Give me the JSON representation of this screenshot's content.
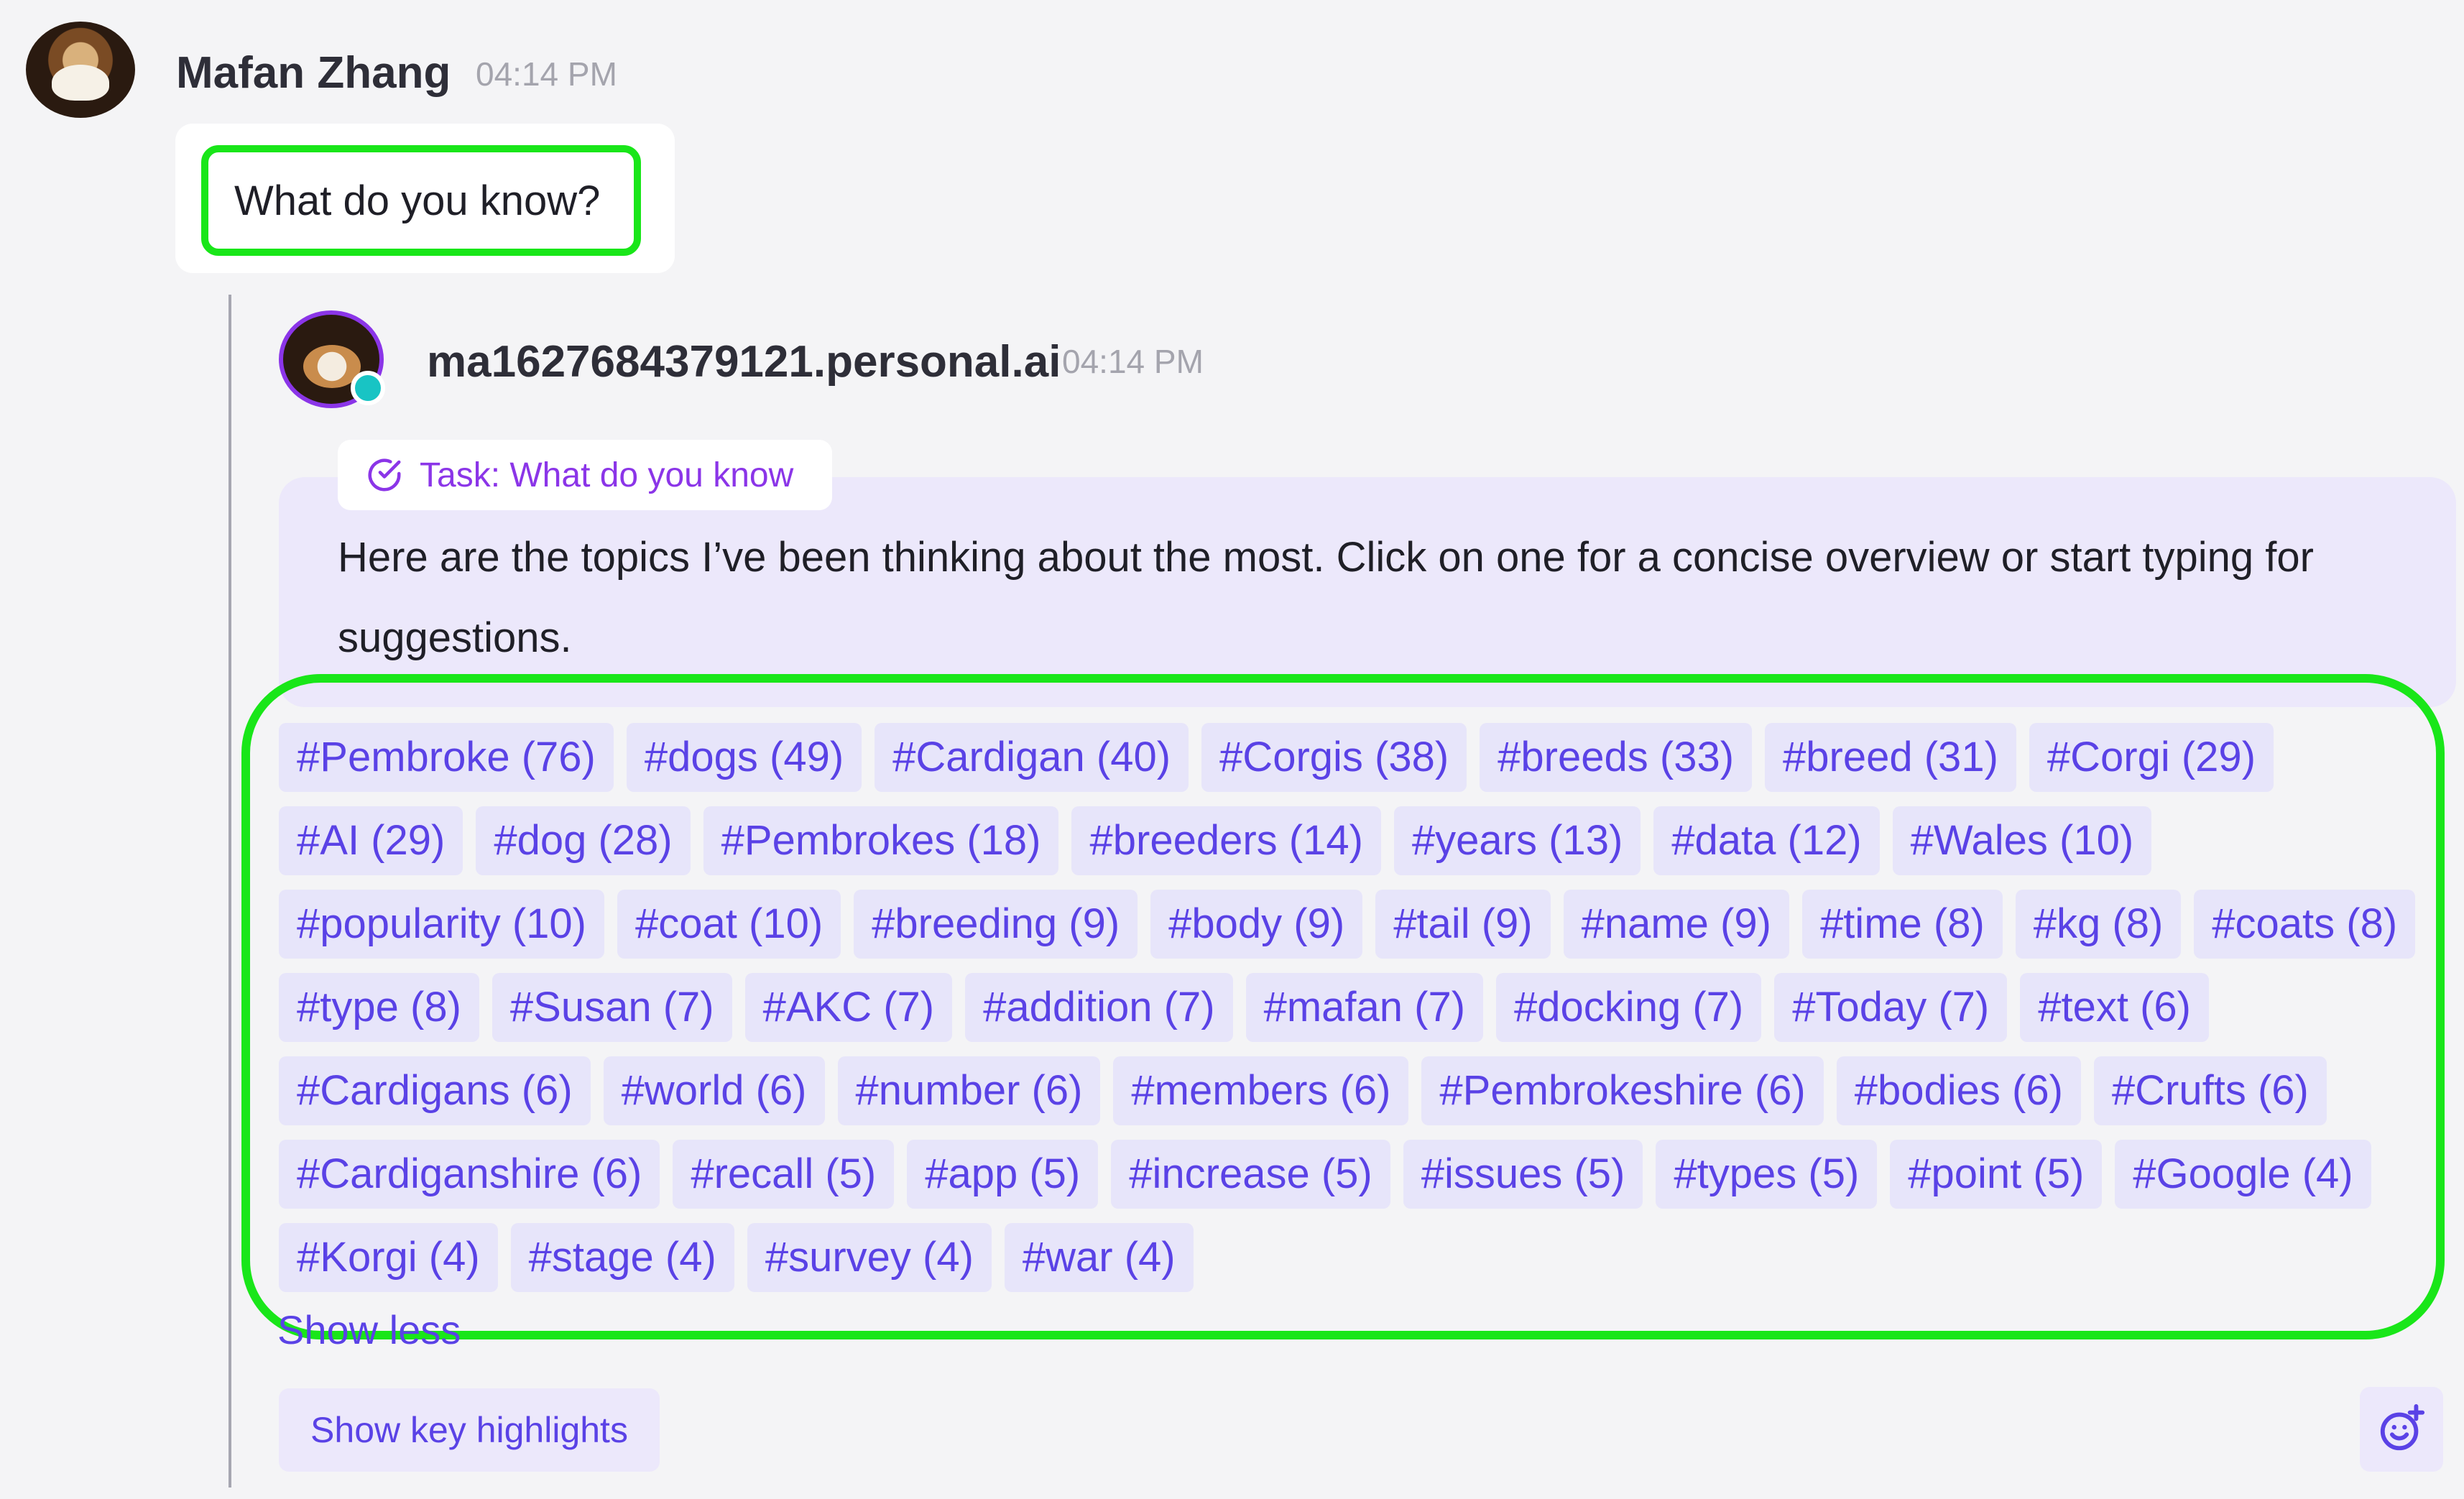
{
  "user_message": {
    "sender": "Mafan Zhang",
    "time": "04:14 PM",
    "text": "What do you know?"
  },
  "ai_message": {
    "sender": "ma1627684379121.personal.ai",
    "time": "04:14 PM",
    "task_label": "Task: What do you know",
    "text": "Here are the topics I’ve been thinking about the most. Click on one for a concise overview or start typing for suggestions.",
    "topics": [
      "#Pembroke (76)",
      "#dogs (49)",
      "#Cardigan (40)",
      "#Corgis (38)",
      "#breeds (33)",
      "#breed (31)",
      "#Corgi (29)",
      "#AI (29)",
      "#dog (28)",
      "#Pembrokes (18)",
      "#breeders (14)",
      "#years (13)",
      "#data (12)",
      "#Wales (10)",
      "#popularity (10)",
      "#coat (10)",
      "#breeding (9)",
      "#body (9)",
      "#tail (9)",
      "#name (9)",
      "#time (8)",
      "#kg (8)",
      "#coats (8)",
      "#type (8)",
      "#Susan (7)",
      "#AKC (7)",
      "#addition (7)",
      "#mafan (7)",
      "#docking (7)",
      "#Today (7)",
      "#text (6)",
      "#Cardigans (6)",
      "#world (6)",
      "#number (6)",
      "#members (6)",
      "#Pembrokeshire (6)",
      "#bodies (6)",
      "#Crufts (6)",
      "#Cardiganshire (6)",
      "#recall (5)",
      "#app (5)",
      "#increase (5)",
      "#issues (5)",
      "#types (5)",
      "#point (5)",
      "#Google (4)",
      "#Korgi (4)",
      "#stage (4)",
      "#survey (4)",
      "#war (4)"
    ],
    "show_less_label": "Show less",
    "key_highlights_label": "Show key highlights"
  },
  "icons": {
    "task": "check-circle-icon",
    "reaction": "emoji-add-icon"
  },
  "colors": {
    "accent": "#5a42e6",
    "purple": "#8b35e8",
    "highlight": "#19e619",
    "bubble": "#ece8fb",
    "online": "#18c4c4"
  }
}
